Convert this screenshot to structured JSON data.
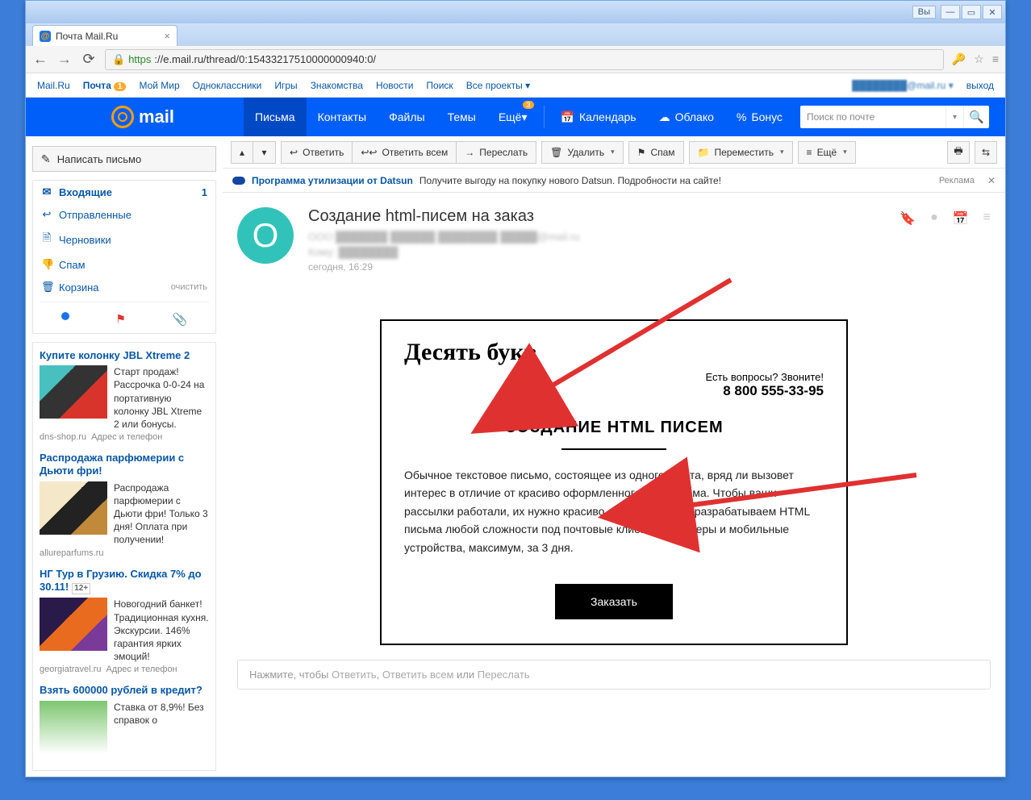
{
  "chrome": {
    "vy": "Вы",
    "tab_title": "Почта Mail.Ru",
    "url_https": "https",
    "url_rest": "://e.mail.ru/thread/0:15433217510000000940:0/"
  },
  "topbar": {
    "links": [
      "Mail.Ru",
      "Почта",
      "Мой Мир",
      "Одноклассники",
      "Игры",
      "Знакомства",
      "Новости",
      "Поиск",
      "Все проекты"
    ],
    "mail_badge": "1",
    "usermail": "████████@mail.ru",
    "dd": "▾",
    "exit": "выход"
  },
  "nav": {
    "logo": "mail",
    "items": [
      "Письма",
      "Контакты",
      "Файлы",
      "Темы",
      "Ещё"
    ],
    "more_badge": "3",
    "right": [
      {
        "icon": "📅",
        "label": "Календарь"
      },
      {
        "icon": "☁",
        "label": "Облако"
      },
      {
        "icon": "%",
        "label": "Бонус"
      }
    ],
    "search_placeholder": "Поиск по почте"
  },
  "sidebar": {
    "compose": "Написать письмо",
    "folders": [
      {
        "icon": "✉",
        "label": "Входящие",
        "count": "1",
        "active": true
      },
      {
        "icon": "↩",
        "label": "Отправленные"
      },
      {
        "icon": "🗎",
        "label": "Черновики"
      },
      {
        "icon": "👎",
        "label": "Спам"
      },
      {
        "icon": "🗑",
        "label": "Корзина",
        "clear": "очистить"
      }
    ],
    "ads": [
      {
        "title": "Купите колонку JBL Xtreme 2",
        "text": "Старт продаж! Рассрочка 0-0-24 на портативную колонку JBL Xtreme 2 или бонусы.",
        "store": "dns-shop.ru",
        "addr": "Адрес и телефон",
        "thumb": "t1"
      },
      {
        "title": "Распродажа парфюмерии с Дьюти фри!",
        "text": "Распродажа парфюмерии с Дьюти фри! Только 3 дня! Оплата при получении!",
        "store": "allureparfums.ru",
        "addr": "",
        "thumb": "t2"
      },
      {
        "title": "НГ Тур в Грузию. Скидка 7% до 30.11!",
        "age": "12+",
        "text": "Новогодний банкет! Традиционная кухня. Экскурсии. 146% гарантия ярких эмоций!",
        "store": "georgiatravel.ru",
        "addr": "Адрес и телефон",
        "thumb": "t3"
      },
      {
        "title": "Взять 600000 рублей в кредит?",
        "text": "Ставка от 8,9%! Без справок о",
        "store": "",
        "addr": "",
        "thumb": "t4"
      }
    ]
  },
  "toolbar": {
    "reply": "Ответить",
    "reply_all": "Ответить всем",
    "forward": "Переслать",
    "delete": "Удалить",
    "spam": "Спам",
    "move": "Переместить",
    "more": "Ещё"
  },
  "adstrip": {
    "link": "Программа утилизации от Datsun",
    "text": "Получите выгоду на покупку нового Datsun. Подробности на сайте!",
    "tag": "Реклама"
  },
  "message": {
    "avatar_letter": "О",
    "subject": "Создание html-писем на заказ",
    "from": "ООО ███████ ██████  ████████ █████@mail.ru",
    "to": "Кому: ████████",
    "date": "сегодня, 16:29"
  },
  "email": {
    "brand": "Десять букв",
    "question": "Есть вопросы? Звоните!",
    "phone": "8 800 555-33-95",
    "heading": "СОЗДАНИЕ HTML ПИСЕМ",
    "body": "Обычное текстовое письмо, состоящее из одного текста, вряд ли вызовет интерес в отличие от красиво оформленного html письма. Чтобы ваши рассылки работали, их нужно красиво оформлять! Мы разрабатываем HTML письма любой сложности под почтовые клиенты, браузеры и мобильные устройства, максимум, за 3 дня.",
    "cta": "Заказать"
  },
  "quickreply": {
    "pre": "Нажмите, чтобы ",
    "reply": "Ответить",
    "sep1": ", ",
    "reply_all": "Ответить всем",
    "sep2": " или ",
    "forward": "Переслать"
  }
}
